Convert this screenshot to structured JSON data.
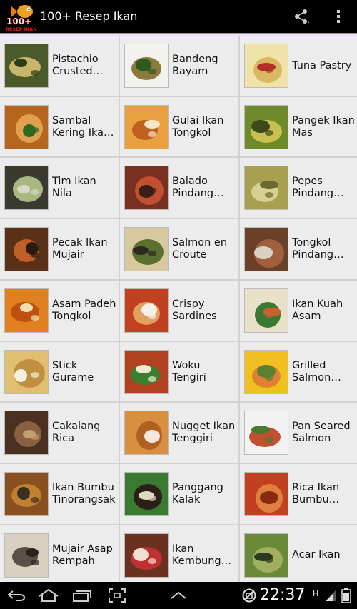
{
  "app": {
    "title": "100+ Resep Ikan",
    "logo_top": "100+",
    "logo_bottom": "RESEP IKAN"
  },
  "recipes": [
    {
      "name": "Pistachio Crusted Salmon",
      "colors": [
        "#4a5a2a",
        "#c8b46a",
        "#2f3b18"
      ]
    },
    {
      "name": "Bandeng Bayam",
      "colors": [
        "#f2f2ee",
        "#8c7a3c",
        "#2f5a1e"
      ]
    },
    {
      "name": "Tuna Pastry",
      "colors": [
        "#f0e2a8",
        "#d8b860",
        "#b0302a"
      ]
    },
    {
      "name": "Sambal Kering Ikan Teri",
      "colors": [
        "#b5651d",
        "#e0a050",
        "#2e6b20"
      ]
    },
    {
      "name": "Gulai Ikan Tongkol",
      "colors": [
        "#e8a040",
        "#c06020",
        "#f5e6c8"
      ]
    },
    {
      "name": "Pangek Ikan Mas",
      "colors": [
        "#6e8a2a",
        "#c8c050",
        "#3a4a18"
      ]
    },
    {
      "name": "Tim Ikan Nila",
      "colors": [
        "#3a3a30",
        "#a8b880",
        "#d8d8c8"
      ]
    },
    {
      "name": "Balado Pindang Mini",
      "colors": [
        "#7a3020",
        "#c05030",
        "#3a2018"
      ]
    },
    {
      "name": "Pepes Pindang Ikan Tongkol",
      "colors": [
        "#a8a050",
        "#d8d090",
        "#6a6a30"
      ]
    },
    {
      "name": "Pecak Ikan Mujair",
      "colors": [
        "#5a3018",
        "#c06028",
        "#2a1a10"
      ]
    },
    {
      "name": "Salmon en Croute",
      "colors": [
        "#d8c8a0",
        "#5a7030",
        "#2a2a20"
      ]
    },
    {
      "name": "Tongkol Pindang Kecap",
      "colors": [
        "#6a4028",
        "#a06040",
        "#d8d0c0"
      ]
    },
    {
      "name": "Asam Padeh Tongkol",
      "colors": [
        "#e08020",
        "#c05010",
        "#f0e0b0"
      ]
    },
    {
      "name": "Crispy Sardines",
      "colors": [
        "#c04020",
        "#e0a060",
        "#f5f0e8"
      ]
    },
    {
      "name": "Ikan Kuah Asam",
      "colors": [
        "#e8e0c8",
        "#3a7a30",
        "#c86030"
      ]
    },
    {
      "name": "Stick Gurame",
      "colors": [
        "#e0c070",
        "#c09040",
        "#f5f0e0"
      ]
    },
    {
      "name": "Woku Tengiri",
      "colors": [
        "#b04020",
        "#3a8030",
        "#f0e8d0"
      ]
    },
    {
      "name": "Grilled Salmon with Mango Salsa",
      "colors": [
        "#f0c020",
        "#e08030",
        "#5a8030"
      ]
    },
    {
      "name": "Cakalang Rica",
      "colors": [
        "#4a3020",
        "#8a6040",
        "#c0a070"
      ]
    },
    {
      "name": "Nugget Ikan Tenggiri",
      "colors": [
        "#d89040",
        "#b06020",
        "#f0e8e0"
      ]
    },
    {
      "name": "Pan Seared Salmon",
      "colors": [
        "#f2f2f2",
        "#c05030",
        "#4a7a30"
      ]
    },
    {
      "name": "Ikan Bumbu Tinorangsak",
      "colors": [
        "#8a5020",
        "#c08030",
        "#3a3020"
      ]
    },
    {
      "name": "Panggang Kalak",
      "colors": [
        "#3a7a30",
        "#2a2018",
        "#e0d8c0"
      ]
    },
    {
      "name": "Rica Ikan Bumbu Pedas",
      "colors": [
        "#c04020",
        "#e08040",
        "#8a2a10"
      ]
    },
    {
      "name": "Mujair Asap Rempah",
      "colors": [
        "#d8d0c0",
        "#5a5048",
        "#2a2420"
      ]
    },
    {
      "name": "Ikan Kembung Bakar",
      "colors": [
        "#6a3020",
        "#c03030",
        "#f0e0d0"
      ]
    },
    {
      "name": "Acar Ikan",
      "colors": [
        "#6a8a3a",
        "#a0b060",
        "#2a3a20"
      ]
    }
  ],
  "status": {
    "time": "22:37",
    "network": "H"
  },
  "icons": {
    "share": "share-icon",
    "overflow": "overflow-menu-icon",
    "back": "back-icon",
    "home": "home-icon",
    "recents": "recent-apps-icon",
    "screenshot": "screenshot-icon",
    "menu": "menu-up-icon"
  }
}
